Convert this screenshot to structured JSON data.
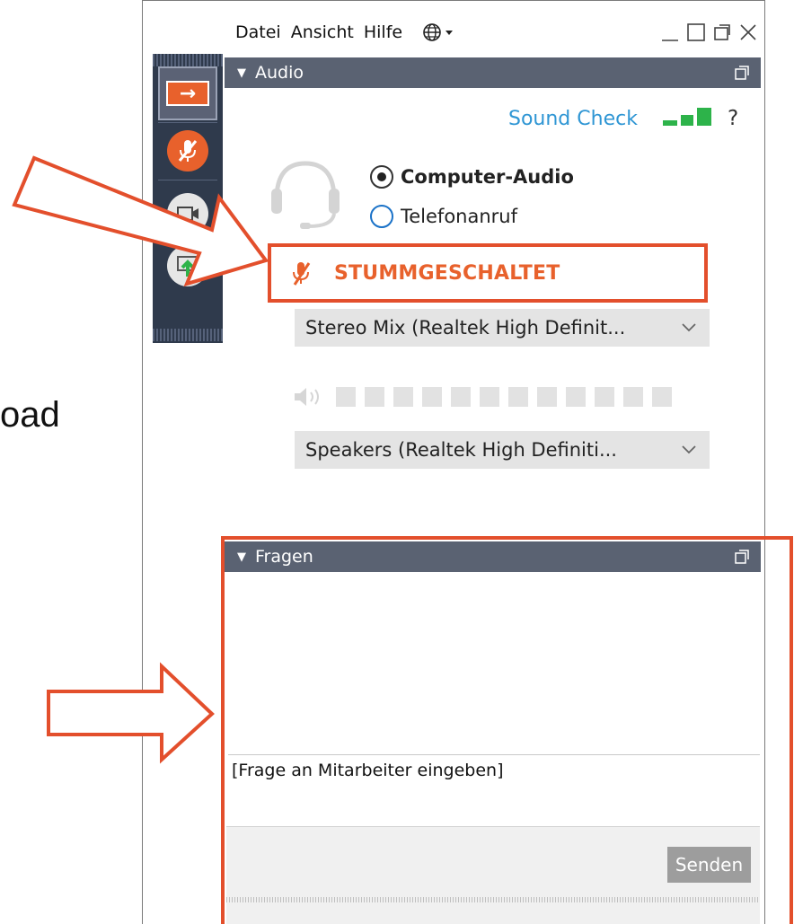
{
  "menu": {
    "items": [
      "Datei",
      "Ansicht",
      "Hilfe"
    ]
  },
  "audio_panel": {
    "title": "Audio",
    "sound_check_label": "Sound Check",
    "help_label": "?",
    "options": [
      {
        "label": "Computer-Audio",
        "selected": true
      },
      {
        "label": "Telefonanruf",
        "selected": false
      }
    ],
    "mute_status": "STUMMGESCHALTET",
    "microphone_device": "Stereo Mix (Realtek High Definit...",
    "speaker_device": "Speakers (Realtek High Definiti..."
  },
  "questions_panel": {
    "title": "Fragen",
    "input_placeholder": "[Frage an Mitarbeiter eingeben]",
    "send_label": "Senden"
  },
  "background_text": "oad",
  "colors": {
    "accent_orange": "#e8612c",
    "annotation_red": "#e34f2c",
    "header_bg": "#5a6272",
    "strip_bg": "#2f3a4c",
    "link_blue": "#2f96d4",
    "signal_green": "#2db34a"
  }
}
